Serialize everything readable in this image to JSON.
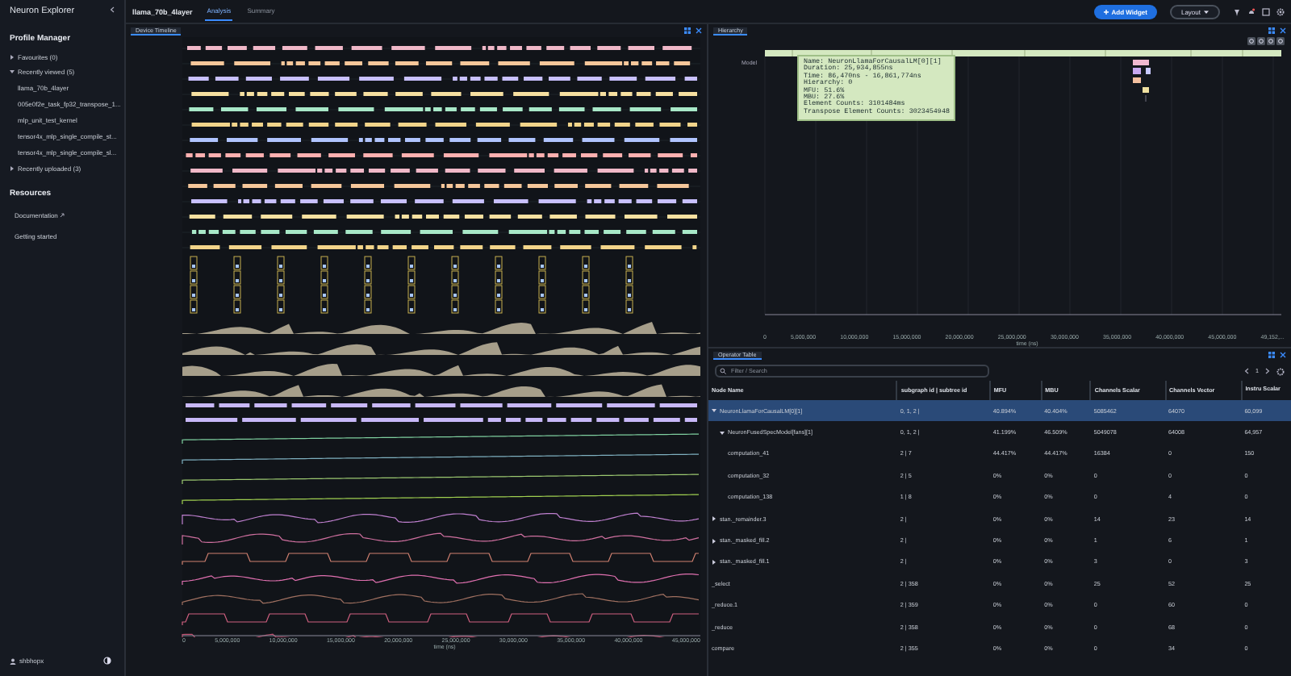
{
  "sidebar": {
    "title": "Neuron Explorer",
    "section": "Profile Manager",
    "groups": [
      {
        "label": "Favourites (0)",
        "expanded": false
      },
      {
        "label": "Recently viewed (5)",
        "expanded": true,
        "items": [
          "llama_70b_4layer",
          "005e0f2e_task_fp32_transpose_1...",
          "mlp_unit_test_kernel",
          "tensor4x_mlp_single_compile_st...",
          "tensor4x_mlp_single_compile_sl..."
        ]
      },
      {
        "label": "Recently uploaded (3)",
        "expanded": false
      }
    ],
    "resources": {
      "title": "Resources",
      "links": [
        {
          "label": "Documentation",
          "external": true
        },
        {
          "label": "Getting started",
          "external": false
        }
      ]
    },
    "user": "shbhopx"
  },
  "topbar": {
    "profile": "llama_70b_4layer",
    "tabs": [
      {
        "label": "Analysis",
        "selected": true
      },
      {
        "label": "Summary",
        "selected": false
      }
    ],
    "buttons": [
      {
        "label": "Add Widget",
        "kind": "primary"
      },
      {
        "label": "Layout",
        "kind": "dropdown"
      }
    ]
  },
  "timeline": {
    "tab": "Device Timeline",
    "xticks": [
      "0",
      "5,000,000",
      "10,000,000",
      "15,000,000",
      "20,000,000",
      "25,000,000",
      "30,000,000",
      "35,000,000",
      "40,000,000",
      "45,000,000"
    ],
    "xlabel": "time (ns)"
  },
  "hierarchy": {
    "tab": "Hierarchy",
    "row_label": "Model",
    "tooltip": [
      "Name: NeuronLlamaForCausalLM[0][1]",
      "Duration: 25,934,855ns",
      "Time: 86,470ns - 16,861,774ns",
      "Hierarchy: 0",
      "MFU: 51.6%",
      "MBU: 27.6%",
      "Element Counts: 3101484ms",
      "Transpose Element Counts: 3023454948"
    ],
    "xticks": [
      "0",
      "5,000,000",
      "10,000,000",
      "15,000,000",
      "20,000,000",
      "25,000,000",
      "30,000,000",
      "35,000,000",
      "40,000,000",
      "45,000,000",
      "49,152,..."
    ],
    "xlabel": "time (ns)"
  },
  "table": {
    "tab": "Operator Table",
    "search": {
      "placeholder": "Filter / Search"
    },
    "page": "1",
    "columns": [
      "Node Name",
      "subgraph id | subtree id",
      "MFU",
      "MBU",
      "Channels Scalar",
      "Channels Vector",
      "Instru Scalar"
    ],
    "rows": [
      {
        "cells": [
          "NeuronLlamaForCausalLM[0][1]",
          "0, 1, 2 |",
          "40.894%",
          "40.404%",
          "5085462",
          "64070",
          "60,099"
        ],
        "selected": true,
        "expanded": true,
        "children": [
          {
            "cells": [
              "NeuronFusedSpecModel[fans][1]",
              "0, 1, 2 |",
              "41.199%",
              "46.509%",
              "5049078",
              "64008",
              "64,957"
            ],
            "selected": false,
            "expanded": true,
            "children": [
              {
                "cells": [
                  "computation_41",
                  "2 | 7",
                  "44.417%",
                  "44.417%",
                  "16384",
                  "0",
                  "150"
                ],
                "selected": false
              },
              {
                "cells": [
                  "computation_32",
                  "2 | 5",
                  "0%",
                  "0%",
                  "0",
                  "0",
                  "0"
                ],
                "selected": false
              },
              {
                "cells": [
                  "computation_138",
                  "1 | 8",
                  "0%",
                  "0%",
                  "0",
                  "4",
                  "0"
                ],
                "selected": false
              }
            ]
          }
        ]
      },
      {
        "cells": [
          "stan._remainder.3",
          "2 |",
          "0%",
          "0%",
          "14",
          "23",
          "14"
        ],
        "selected": false,
        "expanded": false
      },
      {
        "cells": [
          "stan._masked_fill.2",
          "2 |",
          "0%",
          "0%",
          "1",
          "6",
          "1"
        ],
        "selected": false,
        "expanded": false
      },
      {
        "cells": [
          "stan._masked_fill.1",
          "2 |",
          "0%",
          "0%",
          "3",
          "0",
          "3"
        ],
        "selected": false,
        "expanded": false
      },
      {
        "cells": [
          "_select",
          "2 | 358",
          "0%",
          "0%",
          "25",
          "52",
          "25"
        ],
        "selected": false
      },
      {
        "cells": [
          "_reduce.1",
          "2 | 359",
          "0%",
          "0%",
          "0",
          "60",
          "0"
        ],
        "selected": false
      },
      {
        "cells": [
          "_reduce",
          "2 | 358",
          "0%",
          "0%",
          "0",
          "68",
          "0"
        ],
        "selected": false
      },
      {
        "cells": [
          "compare",
          "2 | 355",
          "0%",
          "0%",
          "0",
          "34",
          "0"
        ],
        "selected": false
      }
    ]
  }
}
